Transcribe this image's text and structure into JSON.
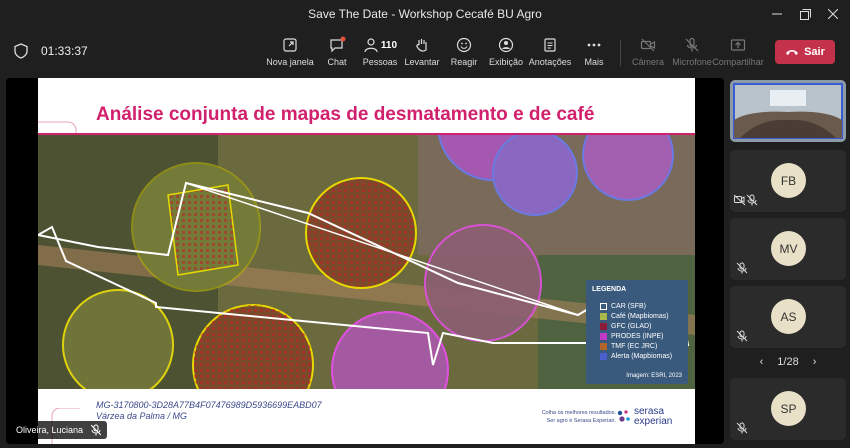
{
  "window": {
    "title": "Save The Date - Workshop Cecafé BU Agro",
    "minimize_icon": "minimize-icon",
    "restore_icon": "restore-icon",
    "close_icon": "close-icon"
  },
  "toolbar": {
    "elapsed": "01:33:37",
    "buttons": [
      {
        "label": "Nova janela",
        "icon": "new-window-icon",
        "enabled": true
      },
      {
        "label": "Chat",
        "icon": "chat-icon",
        "enabled": true
      },
      {
        "label": "Pessoas",
        "icon": "people-icon",
        "count": "110",
        "enabled": true
      },
      {
        "label": "Levantar",
        "icon": "raise-hand-icon",
        "enabled": true
      },
      {
        "label": "Reagir",
        "icon": "react-icon",
        "enabled": true
      },
      {
        "label": "Exibição",
        "icon": "view-icon",
        "enabled": true
      },
      {
        "label": "Anotações",
        "icon": "notes-icon",
        "enabled": true
      },
      {
        "label": "Mais",
        "icon": "more-icon",
        "enabled": true
      },
      {
        "label": "Câmera",
        "icon": "camera-off-icon",
        "enabled": false
      },
      {
        "label": "Microfone",
        "icon": "mic-off-icon",
        "enabled": false
      },
      {
        "label": "Compartilhar",
        "icon": "share-icon",
        "enabled": false
      }
    ],
    "leave_label": "Sair"
  },
  "slide": {
    "title": "Análise conjunta de mapas de desmatamento e de café",
    "legend": {
      "title": "LEGENDA",
      "items": [
        {
          "label": "CAR (SFB)",
          "color": "#ffffff"
        },
        {
          "label": "Café (Mapbiomas)",
          "color": "#a9b84a"
        },
        {
          "label": "GFC (GLAD)",
          "color": "#8a1c3a"
        },
        {
          "label": "PRODES (INPE)",
          "color": "#c23ac8"
        },
        {
          "label": "TMF (EC JRC)",
          "color": "#b0652a"
        },
        {
          "label": "Alerta (Mapbiomas)",
          "color": "#4a5fd0"
        }
      ],
      "footnote": "Imagem: ESRI, 2023"
    },
    "car_id": "MG-3170800-3D28A77B4F07476989D5936699EABD07",
    "location": "Várzea da Palma / MG",
    "tagline_1": "Colha os melhores resultados.",
    "tagline_2": "Ser agro é Serasa Experian.",
    "logo_line1": "serasa",
    "logo_line2": "experian"
  },
  "presenter": {
    "name": "Oliveira, Luciana"
  },
  "participants": [
    {
      "initials": "FB",
      "muted": true
    },
    {
      "initials": "MV",
      "muted": true
    },
    {
      "initials": "AS",
      "muted": true
    },
    {
      "initials": "SP",
      "muted": true
    }
  ],
  "pager": {
    "label": "1/28"
  }
}
